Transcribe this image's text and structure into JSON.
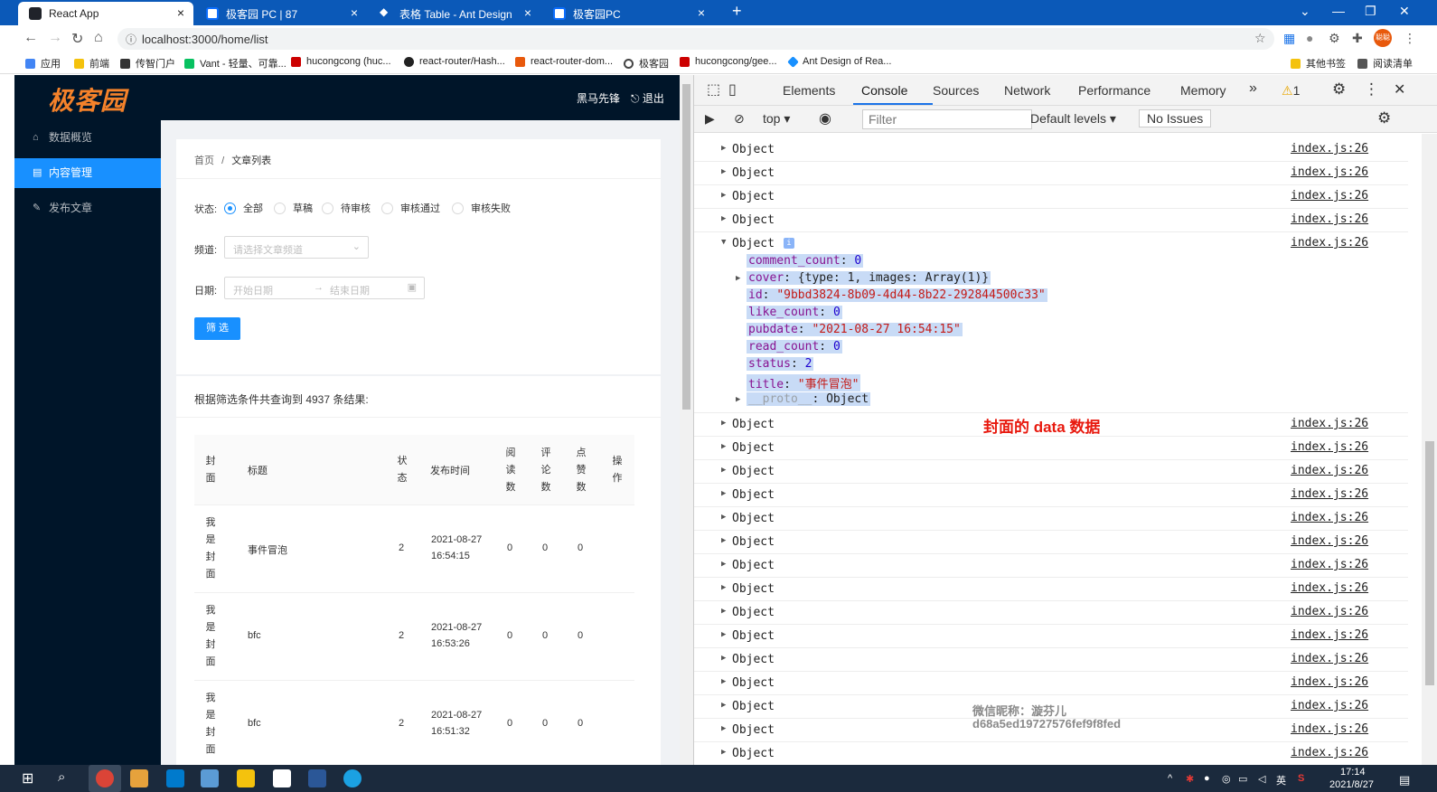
{
  "browser": {
    "tabs": [
      {
        "title": "React App",
        "active": true
      },
      {
        "title": "极客园 PC | 87"
      },
      {
        "title": "表格 Table - Ant Design"
      },
      {
        "title": "极客园PC"
      }
    ],
    "new_tab": "+",
    "url": "localhost:3000/home/list",
    "bookmarks": [
      "应用",
      "前端",
      "传智门户",
      "Vant - 轻量、可靠...",
      "hucongcong (huc...",
      "react-router/Hash...",
      "react-router-dom...",
      "极客园",
      "hucongcong/gee...",
      "Ant Design of Rea...",
      "其他书签",
      "阅读清单"
    ],
    "avatar_text": "聪聪"
  },
  "app": {
    "logo": "极客园",
    "user_name": "黑马先锋",
    "logout": "退出",
    "menu": [
      {
        "label": "数据概览"
      },
      {
        "label": "内容管理",
        "selected": true
      },
      {
        "label": "发布文章"
      }
    ],
    "breadcrumb": {
      "home": "首页",
      "sep": "/",
      "current": "文章列表"
    },
    "filter": {
      "status_label": "状态:",
      "status_options": [
        "全部",
        "草稿",
        "待审核",
        "审核通过",
        "审核失败"
      ],
      "status_selected": "全部",
      "channel_label": "频道:",
      "channel_placeholder": "请选择文章频道",
      "date_label": "日期:",
      "date_start_placeholder": "开始日期",
      "date_end_placeholder": "结束日期",
      "submit": "筛 选"
    },
    "result_text": "根据筛选条件共查询到 4937 条结果:",
    "table": {
      "headers": [
        "封面",
        "标题",
        "状态",
        "发布时间",
        "阅读数",
        "评论数",
        "点赞数",
        "操作"
      ],
      "rows": [
        {
          "cover": "我是封面",
          "title": "事件冒泡",
          "status": "2",
          "date": "2021-08-27",
          "time": "16:54:15",
          "read": "0",
          "comment": "0",
          "like": "0"
        },
        {
          "cover": "我是封面",
          "title": "bfc",
          "status": "2",
          "date": "2021-08-27",
          "time": "16:53:26",
          "read": "0",
          "comment": "0",
          "like": "0"
        },
        {
          "cover": "我是封面",
          "title": "bfc",
          "status": "2",
          "date": "2021-08-27",
          "time": "16:51:32",
          "read": "0",
          "comment": "0",
          "like": "0"
        }
      ]
    }
  },
  "devtools": {
    "tabs": [
      "Elements",
      "Console",
      "Sources",
      "Network",
      "Performance",
      "Memory"
    ],
    "active_tab": "Console",
    "more": "»",
    "warnings": "1",
    "context": "top",
    "filter_placeholder": "Filter",
    "levels": "Default levels",
    "issues": "No Issues",
    "log_label": "Object",
    "log_source": "index.js:26",
    "expanded_props": [
      {
        "key": "comment_count",
        "value": "0",
        "type": "n"
      },
      {
        "key": "cover",
        "value": "{type: 1, images: Array(1)}",
        "type": "p",
        "expandable": true
      },
      {
        "key": "id",
        "value": "\"9bbd3824-8b09-4d44-8b22-292844500c33\"",
        "type": "s"
      },
      {
        "key": "like_count",
        "value": "0",
        "type": "n"
      },
      {
        "key": "pubdate",
        "value": "\"2021-08-27 16:54:15\"",
        "type": "s"
      },
      {
        "key": "read_count",
        "value": "0",
        "type": "n"
      },
      {
        "key": "status",
        "value": "2",
        "type": "n"
      },
      {
        "key": "title",
        "value": "\"事件冒泡\"",
        "type": "s"
      },
      {
        "key": "__proto__",
        "value": "Object",
        "type": "p",
        "expandable": true
      }
    ],
    "annotation": "封面的 data 数据",
    "watermark_line1": "微信昵称：漩芬儿",
    "watermark_line2": "d68a5ed19727576fef9f8fed"
  },
  "taskbar": {
    "time": "17:14",
    "date": "2021/8/27",
    "ime": "英"
  },
  "colors": {
    "chrome_blue": "#0b59b8",
    "antd_primary": "#1890ff",
    "sider_bg": "#001529",
    "logo_orange": "#f5822a",
    "annotation_red": "#e8190e"
  }
}
